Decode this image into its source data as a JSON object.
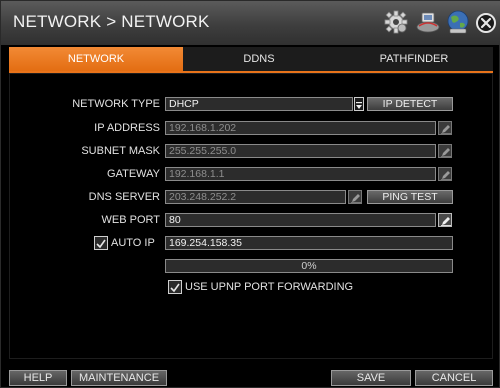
{
  "window": {
    "title": "NETWORK > NETWORK"
  },
  "title_icons": [
    "gear-icon",
    "network-devices-icon",
    "globe-icon",
    "close-icon"
  ],
  "tabs": [
    {
      "label": "NETWORK",
      "active": true
    },
    {
      "label": "DDNS",
      "active": false
    },
    {
      "label": "PATHFINDER",
      "active": false
    }
  ],
  "form": {
    "network_type": {
      "label": "NETWORK TYPE",
      "value": "DHCP",
      "button": "IP DETECT"
    },
    "ip_address": {
      "label": "IP ADDRESS",
      "value": "192.168.1.202"
    },
    "subnet_mask": {
      "label": "SUBNET MASK",
      "value": "255.255.255.0"
    },
    "gateway": {
      "label": "GATEWAY",
      "value": "192.168.1.1"
    },
    "dns_server": {
      "label": "DNS SERVER",
      "value": "203.248.252.2",
      "button": "PING TEST"
    },
    "web_port": {
      "label": "WEB PORT",
      "value": "80"
    },
    "auto_ip": {
      "label": "AUTO IP",
      "checked": true,
      "value": "169.254.158.35"
    },
    "progress": {
      "text": "0%",
      "value": 0
    },
    "upnp": {
      "label": "USE UPNP PORT FORWARDING",
      "checked": true
    }
  },
  "footer": {
    "help": "HELP",
    "maintenance": "MAINTENANCE",
    "save": "SAVE",
    "cancel": "CANCEL"
  },
  "colors": {
    "accent": "#e8731a",
    "progress_fill": "#5d8ad0"
  }
}
